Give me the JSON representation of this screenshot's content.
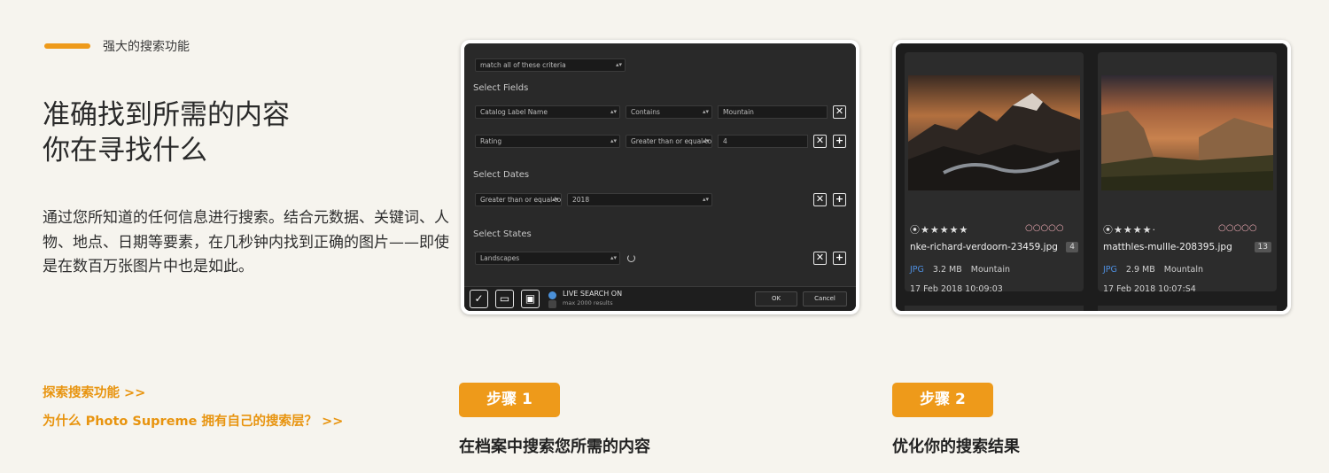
{
  "eyebrow": {
    "text": "强大的搜索功能"
  },
  "headline": {
    "line1": "准确找到所需的内容",
    "line2": "你在寻找什么"
  },
  "body": {
    "text": "通过您所知道的任何信息进行搜索。结合元数据、关键词、人物、地点、日期等要素，在几秒钟内找到正确的图片——即使是在数百万张图片中也是如此。"
  },
  "links": {
    "explore": "探索搜索功能 >>",
    "why_prefix": "为什么 ",
    "why_brand": "Photo Supreme",
    "why_suffix": " 拥有自己的搜索层？ >>"
  },
  "search_dialog": {
    "match_select": "match all of these criteria",
    "fields_heading": "Select Fields",
    "row1": {
      "field": "Catalog Label Name",
      "op": "Contains",
      "value": "Mountain"
    },
    "row2": {
      "field": "Rating",
      "op": "Greater than or equal to",
      "value": "4"
    },
    "dates_heading": "Select Dates",
    "date_row": {
      "op": "Greater than or equal to",
      "value": "2018"
    },
    "states_heading": "Select States",
    "state_row": {
      "value": "Landscapes"
    },
    "live_search_title": "LIVE SEARCH ON",
    "live_search_sub": "max 2000 results",
    "ok_label": "OK",
    "cancel_label": "Cancel",
    "remove_glyph": "✕",
    "add_glyph": "+",
    "arrow_glyph": "▴▾",
    "check_glyph": "✓",
    "folder_glyph": "▭",
    "save_glyph": "▣"
  },
  "results": [
    {
      "rating": "⦿★★★★★",
      "labels": "○○○○○",
      "filename": "nke-richard-verdoorn-23459.jpg",
      "count": "4",
      "ext": "JPG",
      "size": "3.2 MB",
      "keyword": "Mountain",
      "date": "17 Feb 2018 10:09:03"
    },
    {
      "rating": "⦿★★★★·",
      "labels": "○○○○○",
      "filename": "matthles-mullle-208395.jpg",
      "count": "13",
      "ext": "JPG",
      "size": "2.9 MB",
      "keyword": "Mountaln",
      "date": "17 Feb 2018 10:07:S4"
    }
  ],
  "steps": [
    {
      "badge": "步骤 1",
      "title": "在档案中搜索您所需的内容"
    },
    {
      "badge": "步骤 2",
      "title": "优化你的搜索结果"
    }
  ],
  "colors": {
    "accent": "#ee9a1a",
    "background": "#f6f4ee",
    "link": "#e8940f",
    "jpg_blue": "#4e8fe0"
  }
}
